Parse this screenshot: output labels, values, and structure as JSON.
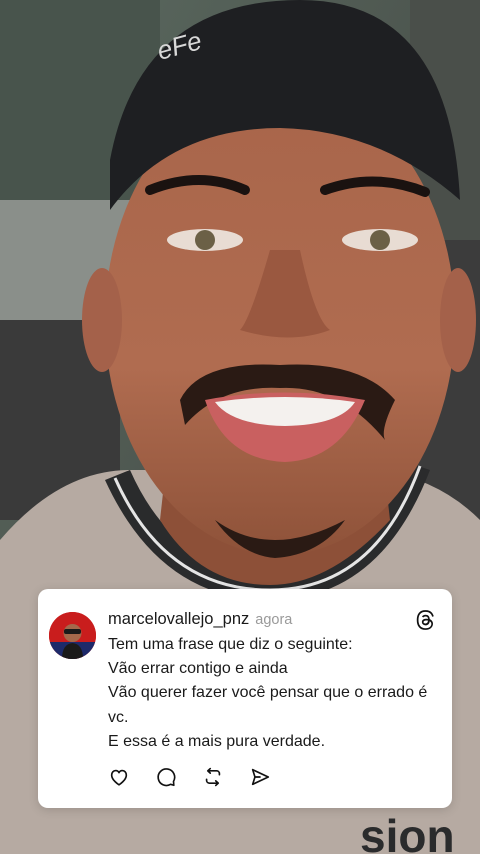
{
  "post": {
    "username": "marcelovallejo_pnz",
    "timestamp": "agora",
    "lines": [
      "Tem uma frase que diz o seguinte:",
      "Vão errar contigo e ainda",
      "Vão querer fazer você pensar que o errado é vc.",
      "E essa é a mais pura verdade."
    ]
  },
  "icons": {
    "platform": "threads-icon",
    "actions": [
      "heart-icon",
      "comment-icon",
      "repost-icon",
      "share-icon"
    ]
  },
  "colors": {
    "card_background": "#ffffff",
    "text": "#1a1a1a",
    "timestamp": "#9a9a9a"
  }
}
